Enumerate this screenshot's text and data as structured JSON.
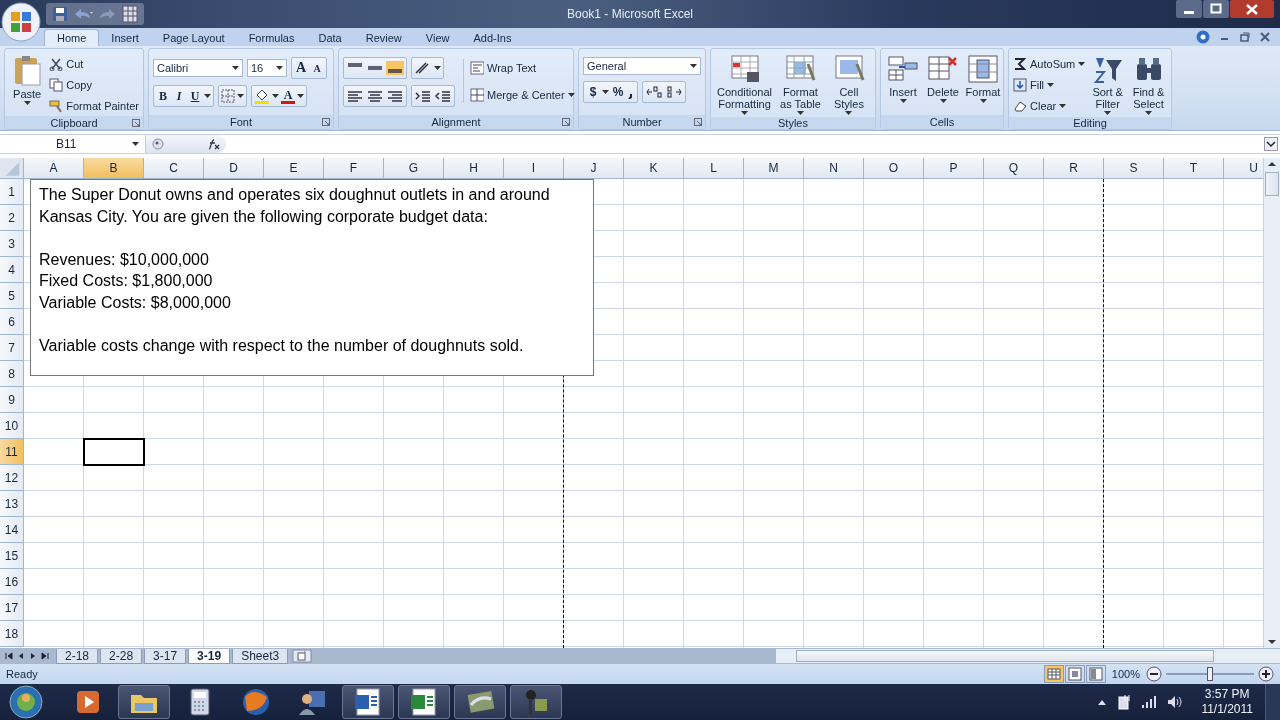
{
  "window": {
    "title": "Book1 - Microsoft Excel"
  },
  "ribbon": {
    "tabs": [
      {
        "label": "Home",
        "selected": true
      },
      {
        "label": "Insert",
        "selected": false
      },
      {
        "label": "Page Layout",
        "selected": false
      },
      {
        "label": "Formulas",
        "selected": false
      },
      {
        "label": "Data",
        "selected": false
      },
      {
        "label": "Review",
        "selected": false
      },
      {
        "label": "View",
        "selected": false
      },
      {
        "label": "Add-Ins",
        "selected": false
      }
    ],
    "groups": [
      {
        "kind": "clipboard",
        "label": "Clipboard",
        "big": "Paste",
        "small": [
          "Cut",
          "Copy",
          "Format Painter"
        ]
      },
      {
        "kind": "font",
        "label": "Font",
        "font": "Calibri",
        "size": "16",
        "grow": "A",
        "shrink": "A",
        "styles": [
          "B",
          "I",
          "U"
        ],
        "font_color_label": "A"
      },
      {
        "kind": "alignment",
        "label": "Alignment",
        "small": [
          "Wrap Text",
          "Merge & Center"
        ]
      },
      {
        "kind": "number",
        "label": "Number",
        "format": "General",
        "small": [
          "$",
          "%"
        ]
      },
      {
        "kind": "big",
        "label": "Styles",
        "big": [
          "Conditional\nFormatting",
          "Format\nas Table",
          "Cell\nStyles"
        ]
      },
      {
        "kind": "cells",
        "label": "Cells",
        "big": [
          "Insert",
          "Delete",
          "Format"
        ]
      },
      {
        "kind": "editing",
        "label": "Editing",
        "small": [
          "AutoSum",
          "Fill",
          "Clear"
        ],
        "big": [
          "Sort &\nFilter",
          "Find &\nSelect"
        ]
      }
    ]
  },
  "formula_bar": {
    "name_box": "B11"
  },
  "columns": [
    {
      "label": "A",
      "selected": false,
      "page_break": false
    },
    {
      "label": "B",
      "selected": true,
      "page_break": false
    },
    {
      "label": "C",
      "selected": false,
      "page_break": false
    },
    {
      "label": "D",
      "selected": false,
      "page_break": false
    },
    {
      "label": "E",
      "selected": false,
      "page_break": false
    },
    {
      "label": "F",
      "selected": false,
      "page_break": false
    },
    {
      "label": "G",
      "selected": false,
      "page_break": false
    },
    {
      "label": "H",
      "selected": false,
      "page_break": false
    },
    {
      "label": "I",
      "selected": false,
      "page_break": true
    },
    {
      "label": "J",
      "selected": false,
      "page_break": false
    },
    {
      "label": "K",
      "selected": false,
      "page_break": false
    },
    {
      "label": "L",
      "selected": false,
      "page_break": false
    },
    {
      "label": "M",
      "selected": false,
      "page_break": false
    },
    {
      "label": "N",
      "selected": false,
      "page_break": false
    },
    {
      "label": "O",
      "selected": false,
      "page_break": false
    },
    {
      "label": "P",
      "selected": false,
      "page_break": false
    },
    {
      "label": "Q",
      "selected": false,
      "page_break": false
    },
    {
      "label": "R",
      "selected": false,
      "page_break": true
    },
    {
      "label": "S",
      "selected": false,
      "page_break": false
    },
    {
      "label": "T",
      "selected": false,
      "page_break": false
    },
    {
      "label": "U",
      "selected": false,
      "page_break": false
    }
  ],
  "rows": [
    {
      "label": "1",
      "selected": false
    },
    {
      "label": "2",
      "selected": false
    },
    {
      "label": "3",
      "selected": false
    },
    {
      "label": "4",
      "selected": false
    },
    {
      "label": "5",
      "selected": false
    },
    {
      "label": "6",
      "selected": false
    },
    {
      "label": "7",
      "selected": false
    },
    {
      "label": "8",
      "selected": false
    },
    {
      "label": "9",
      "selected": false
    },
    {
      "label": "10",
      "selected": false
    },
    {
      "label": "11",
      "selected": true
    },
    {
      "label": "12",
      "selected": false
    },
    {
      "label": "13",
      "selected": false
    },
    {
      "label": "14",
      "selected": false
    },
    {
      "label": "15",
      "selected": false
    },
    {
      "label": "16",
      "selected": false
    },
    {
      "label": "17",
      "selected": false
    },
    {
      "label": "18",
      "selected": false
    }
  ],
  "text_box": {
    "paragraphs": [
      {
        "lines": [
          "The Super Donut owns and operates six doughnut outlets in and around",
          "Kansas City. You are given the following corporate budget data:"
        ]
      },
      {
        "lines": [
          "Revenues: $10,000,000",
          "Fixed Costs: $1,800,000",
          "Variable Costs: $8,000,000"
        ]
      },
      {
        "lines": [
          "Variable costs change with respect to the number of doughnuts sold."
        ]
      }
    ]
  },
  "sheet_tabs": [
    {
      "label": "2-18",
      "selected": false
    },
    {
      "label": "2-28",
      "selected": false
    },
    {
      "label": "3-17",
      "selected": false
    },
    {
      "label": "3-19",
      "selected": true
    },
    {
      "label": "Sheet3",
      "selected": false
    }
  ],
  "status_bar": {
    "status": "Ready",
    "views": [
      {
        "kind": "normal",
        "selected": true
      },
      {
        "kind": "layout",
        "selected": false
      },
      {
        "kind": "breaks",
        "selected": false
      }
    ],
    "zoom": "100%",
    "zoom_slider": {
      "level": 0.5
    }
  },
  "taskbar": {
    "buttons": [
      {
        "kind": "media",
        "running": false
      },
      {
        "kind": "folder",
        "running": true
      },
      {
        "kind": "calculator",
        "running": false
      },
      {
        "kind": "browser",
        "running": false
      },
      {
        "kind": "tool",
        "running": false
      },
      {
        "kind": "word",
        "running": true
      },
      {
        "kind": "excel",
        "running": true
      },
      {
        "kind": "photo",
        "running": true
      },
      {
        "kind": "lamp",
        "running": true
      }
    ],
    "time": "3:57 PM",
    "date": "11/1/2011"
  }
}
